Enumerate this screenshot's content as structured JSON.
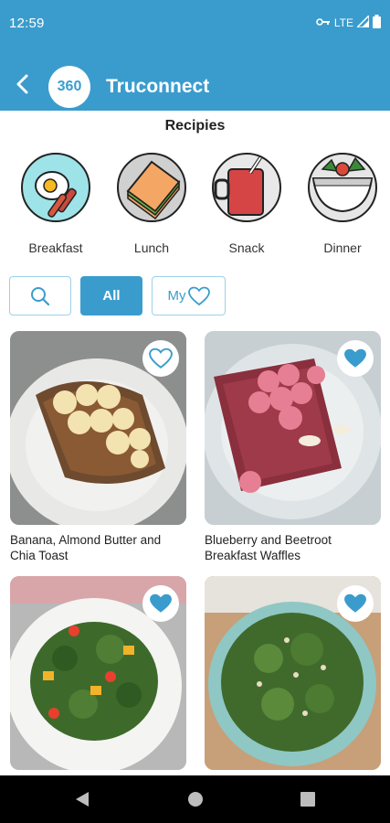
{
  "status": {
    "time": "12:59",
    "network": "LTE"
  },
  "app": {
    "logo_text": "360",
    "title": "Truconnect"
  },
  "section_title": "Recipies",
  "categories": [
    {
      "label": "Breakfast",
      "icon": "breakfast-icon"
    },
    {
      "label": "Lunch",
      "icon": "sandwich-icon"
    },
    {
      "label": "Snack",
      "icon": "drink-icon"
    },
    {
      "label": "Dinner",
      "icon": "dinner-bowl-icon"
    }
  ],
  "filters": {
    "all_label": "All",
    "my_label": "My"
  },
  "recipes": [
    {
      "title": "Banana, Almond Butter and Chia Toast",
      "favorited": false
    },
    {
      "title": "Blueberry and Beetroot Breakfast Waffles",
      "favorited": true
    },
    {
      "title": "",
      "favorited": true
    },
    {
      "title": "",
      "favorited": true
    }
  ],
  "colors": {
    "primary": "#3a9ccd",
    "heart": "#3a9ccd"
  }
}
